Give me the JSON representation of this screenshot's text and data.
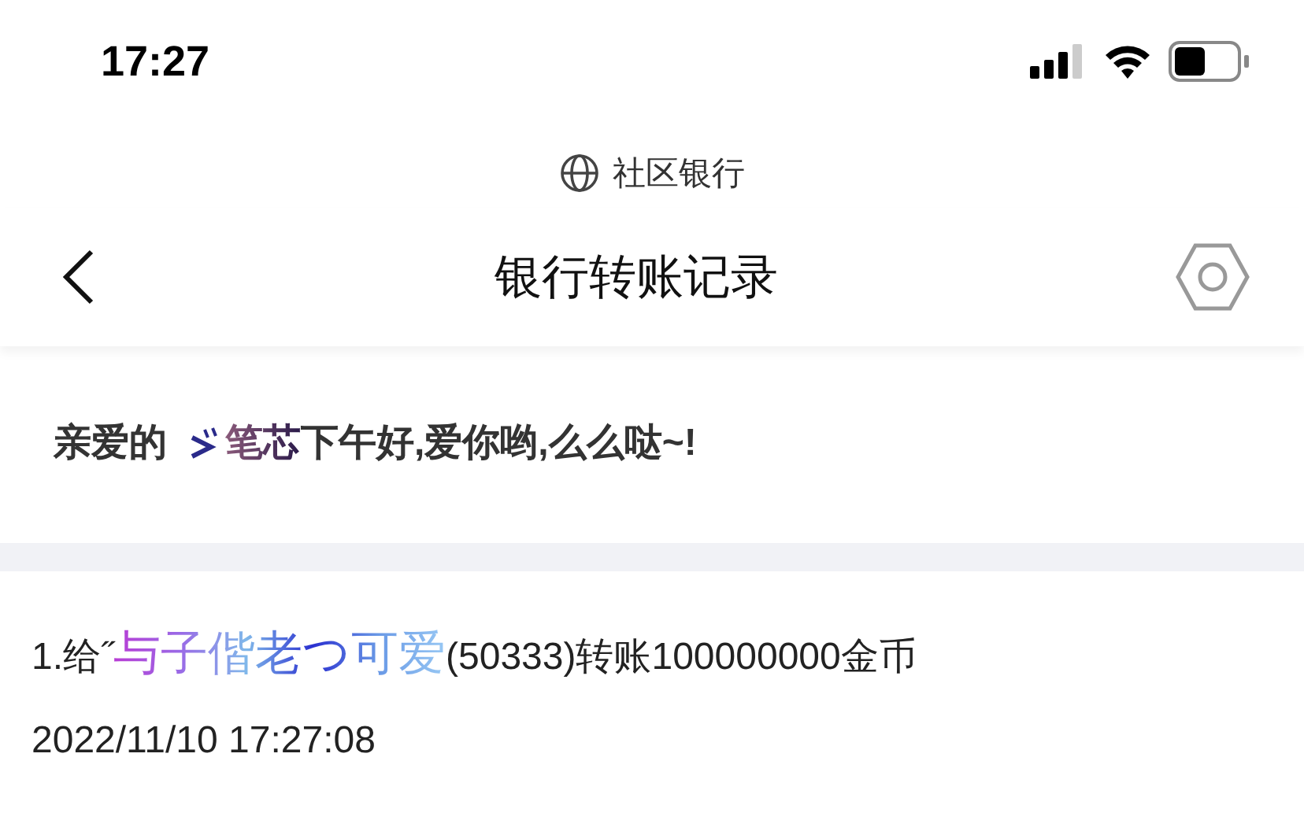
{
  "status_bar": {
    "time": "17:27"
  },
  "browser": {
    "site": "社区银行"
  },
  "nav": {
    "title": "银行转账记录"
  },
  "greeting": {
    "prefix": "亲爱的",
    "name": "笔芯",
    "suffix": "下午好,爱你哟,么么哒~!"
  },
  "records": [
    {
      "prefix": "1.给˝",
      "nickname": "与子偕老つ可爱",
      "suffix": "(50333)转账100000000金币",
      "time": "2022/11/10 17:27:08"
    }
  ]
}
